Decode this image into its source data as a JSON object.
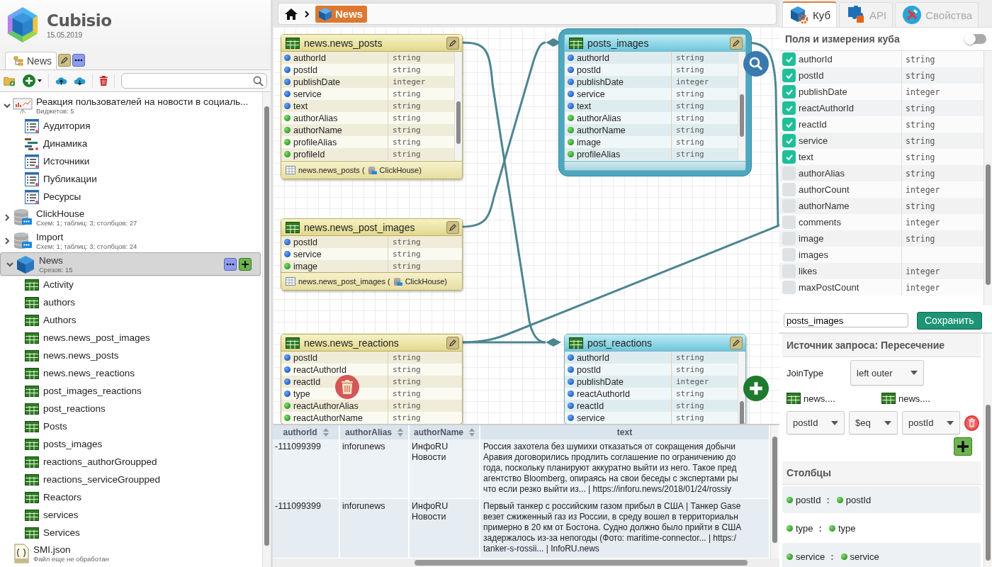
{
  "app": {
    "name": "Cubisio",
    "date": "15.05.2019"
  },
  "project_tab": {
    "label": "News",
    "selected": true
  },
  "tree": [
    {
      "kind": "dashboard",
      "label": "Реакция пользователей на новости в социаль...",
      "subtitle": "Виджетов: 5",
      "expanded": true,
      "selected": false,
      "children": [
        {
          "kind": "list",
          "label": "Аудитория",
          "selected": false
        },
        {
          "kind": "gantt",
          "label": "Динамика",
          "selected": false
        },
        {
          "kind": "list",
          "label": "Источники",
          "selected": false
        },
        {
          "kind": "list",
          "label": "Публикации",
          "selected": false
        },
        {
          "kind": "list",
          "label": "Ресурсы",
          "selected": false
        }
      ]
    },
    {
      "kind": "database",
      "label": "ClickHouse",
      "subtitle": "Схем: 1; таблиц: 3; столбцов: 27",
      "expanded": false,
      "selected": false
    },
    {
      "kind": "database",
      "label": "Import",
      "subtitle": "Схем: 1; таблиц: 3; столбцов: 24",
      "expanded": false,
      "selected": false
    },
    {
      "kind": "cube",
      "label": "News",
      "subtitle": "Срезов: 15",
      "expanded": true,
      "selected": true,
      "children": [
        {
          "kind": "table",
          "label": "Activity",
          "selected": false
        },
        {
          "kind": "table",
          "label": "authors",
          "selected": false
        },
        {
          "kind": "table",
          "label": "Authors",
          "selected": false
        },
        {
          "kind": "table",
          "label": "news.news_post_images",
          "selected": false
        },
        {
          "kind": "table",
          "label": "news.news_posts",
          "selected": false
        },
        {
          "kind": "table",
          "label": "news.news_reactions",
          "selected": false
        },
        {
          "kind": "table",
          "label": "post_images_reactions",
          "selected": false
        },
        {
          "kind": "table",
          "label": "post_reactions",
          "selected": false
        },
        {
          "kind": "table",
          "label": "Posts",
          "selected": false
        },
        {
          "kind": "table",
          "label": "posts_images",
          "selected": false
        },
        {
          "kind": "table",
          "label": "reactions_authorGroupped",
          "selected": false
        },
        {
          "kind": "table",
          "label": "reactions_serviceGroupped",
          "selected": false
        },
        {
          "kind": "table",
          "label": "Reactors",
          "selected": false
        },
        {
          "kind": "table",
          "label": "services",
          "selected": false
        },
        {
          "kind": "table",
          "label": "Services",
          "selected": false
        }
      ]
    },
    {
      "kind": "file",
      "label": "SMI.json",
      "subtitle": "Файл еще не обработан",
      "selected": false
    }
  ],
  "breadcrumb": {
    "label": "News"
  },
  "nodes": [
    {
      "kind": "source",
      "title": "news.news_posts",
      "selected": false,
      "fields": [
        {
          "name": "authorId",
          "type": "string",
          "key": true
        },
        {
          "name": "postId",
          "type": "string",
          "key": true
        },
        {
          "name": "publishDate",
          "type": "integer",
          "key": true
        },
        {
          "name": "service",
          "type": "string",
          "key": true
        },
        {
          "name": "text",
          "type": "string",
          "key": true
        },
        {
          "name": "authorAlias",
          "type": "string",
          "key": false
        },
        {
          "name": "authorName",
          "type": "string",
          "key": false
        },
        {
          "name": "profileAlias",
          "type": "string",
          "key": false
        },
        {
          "name": "profileId",
          "type": "string",
          "key": false
        }
      ],
      "footer": {
        "table": "news.news_posts (",
        "source": "ClickHouse)"
      }
    },
    {
      "kind": "slice",
      "title": "posts_images",
      "selected": true,
      "fields": [
        {
          "name": "authorId",
          "type": "string",
          "key": true
        },
        {
          "name": "postId",
          "type": "string",
          "key": true
        },
        {
          "name": "publishDate",
          "type": "integer",
          "key": true
        },
        {
          "name": "service",
          "type": "string",
          "key": true
        },
        {
          "name": "text",
          "type": "string",
          "key": true
        },
        {
          "name": "authorAlias",
          "type": "string",
          "key": false
        },
        {
          "name": "authorName",
          "type": "string",
          "key": false
        },
        {
          "name": "image",
          "type": "string",
          "key": false
        },
        {
          "name": "profileAlias",
          "type": "string",
          "key": false
        }
      ]
    },
    {
      "kind": "source",
      "title": "news.news_post_images",
      "selected": false,
      "fields": [
        {
          "name": "postId",
          "type": "string",
          "key": true
        },
        {
          "name": "service",
          "type": "string",
          "key": true
        },
        {
          "name": "image",
          "type": "string",
          "key": false
        }
      ],
      "footer": {
        "table": "news.news_post_images (",
        "source": "ClickHouse)"
      }
    },
    {
      "kind": "source",
      "title": "news.news_reactions",
      "selected": false,
      "fields": [
        {
          "name": "postId",
          "type": "string",
          "key": true
        },
        {
          "name": "reactAuthorId",
          "type": "string",
          "key": true
        },
        {
          "name": "reactId",
          "type": "string",
          "key": true
        },
        {
          "name": "type",
          "type": "string",
          "key": true
        },
        {
          "name": "reactAuthorAlias",
          "type": "string",
          "key": false
        },
        {
          "name": "reactAuthorName",
          "type": "string",
          "key": false
        }
      ]
    },
    {
      "kind": "slice",
      "title": "post_reactions",
      "selected": false,
      "fields": [
        {
          "name": "authorId",
          "type": "string",
          "key": true
        },
        {
          "name": "postId",
          "type": "string",
          "key": true
        },
        {
          "name": "publishDate",
          "type": "integer",
          "key": true
        },
        {
          "name": "reactAuthorId",
          "type": "string",
          "key": true
        },
        {
          "name": "reactId",
          "type": "string",
          "key": true
        },
        {
          "name": "service",
          "type": "string",
          "key": true
        }
      ]
    }
  ],
  "data_grid": {
    "columns": [
      {
        "label": "authorId",
        "sortable": true
      },
      {
        "label": "authorAlias",
        "sortable": true
      },
      {
        "label": "authorName",
        "sortable": true
      },
      {
        "label": "text",
        "sortable": false
      }
    ],
    "rows": [
      {
        "cells": [
          "-111099399",
          "inforunews",
          "ИнфоRU Новости",
          "Россия захотела без шумихи отказаться от сокращения добычи\nАравия договорились продлить соглашение по ограничению до\nгода, поскольку планируют аккуратно выйти из него. Такое пред\nагентство Bloomberg, опираясь на свои беседы с экспертами ры\nчто если резко выйти из... | https://inforu.news/2018/01/24/rossiy"
        ]
      },
      {
        "cells": [
          "-111099399",
          "inforunews",
          "ИнфоRU Новости",
          "Первый танкер с российским газом прибыл в США | Танкер Gase\nвезет сжиженный газ из России, в среду вошел в территориальн\nпримерно в 20 км от Бостона. Судно должно было прийти в США\nзадержалось из-за непогоды (Фото: maritime-connector... | https:/\ntanker-s-rossii... | InfoRU.news"
        ]
      }
    ]
  },
  "side_tabs": [
    {
      "kind": "cube",
      "label": "Куб",
      "selected": true
    },
    {
      "kind": "api",
      "label": "API",
      "selected": false
    },
    {
      "kind": "properties",
      "label": "Свойства",
      "selected": false
    }
  ],
  "cube_fields": {
    "title": "Поля и измерения куба",
    "on": false,
    "items": [
      {
        "name": "authorId",
        "type": "string",
        "checked": true
      },
      {
        "name": "postId",
        "type": "string",
        "checked": true
      },
      {
        "name": "publishDate",
        "type": "integer",
        "checked": true
      },
      {
        "name": "reactAuthorId",
        "type": "string",
        "checked": true
      },
      {
        "name": "reactId",
        "type": "string",
        "checked": true
      },
      {
        "name": "service",
        "type": "string",
        "checked": true
      },
      {
        "name": "text",
        "type": "string",
        "checked": true
      },
      {
        "name": "authorAlias",
        "type": "string",
        "checked": false
      },
      {
        "name": "authorCount",
        "type": "integer",
        "checked": false
      },
      {
        "name": "authorName",
        "type": "string",
        "checked": false
      },
      {
        "name": "comments",
        "type": "integer",
        "checked": false
      },
      {
        "name": "image",
        "type": "string",
        "checked": false
      },
      {
        "name": "images",
        "checked": false
      },
      {
        "name": "likes",
        "type": "integer",
        "checked": false
      },
      {
        "name": "maxPostCount",
        "type": "integer",
        "checked": false
      }
    ]
  },
  "slice_name": {
    "value": "posts_images"
  },
  "save_button": {
    "label": "Сохранить"
  },
  "query_source": {
    "title": "Источник запроса: Пересечение",
    "join_label": "JoinType",
    "join_type": "left outer",
    "left_table": "news....",
    "right_table": "news....",
    "condition": {
      "left": "postId",
      "operator": "$eq",
      "right": "postId"
    }
  },
  "columns_section": {
    "title": "Столбцы",
    "mappings": [
      {
        "left": "postId",
        "separator": ":",
        "right": "postId"
      },
      {
        "left": "type",
        "separator": ":",
        "right": "type"
      },
      {
        "left": "service",
        "separator": ":",
        "right": "service"
      }
    ]
  }
}
